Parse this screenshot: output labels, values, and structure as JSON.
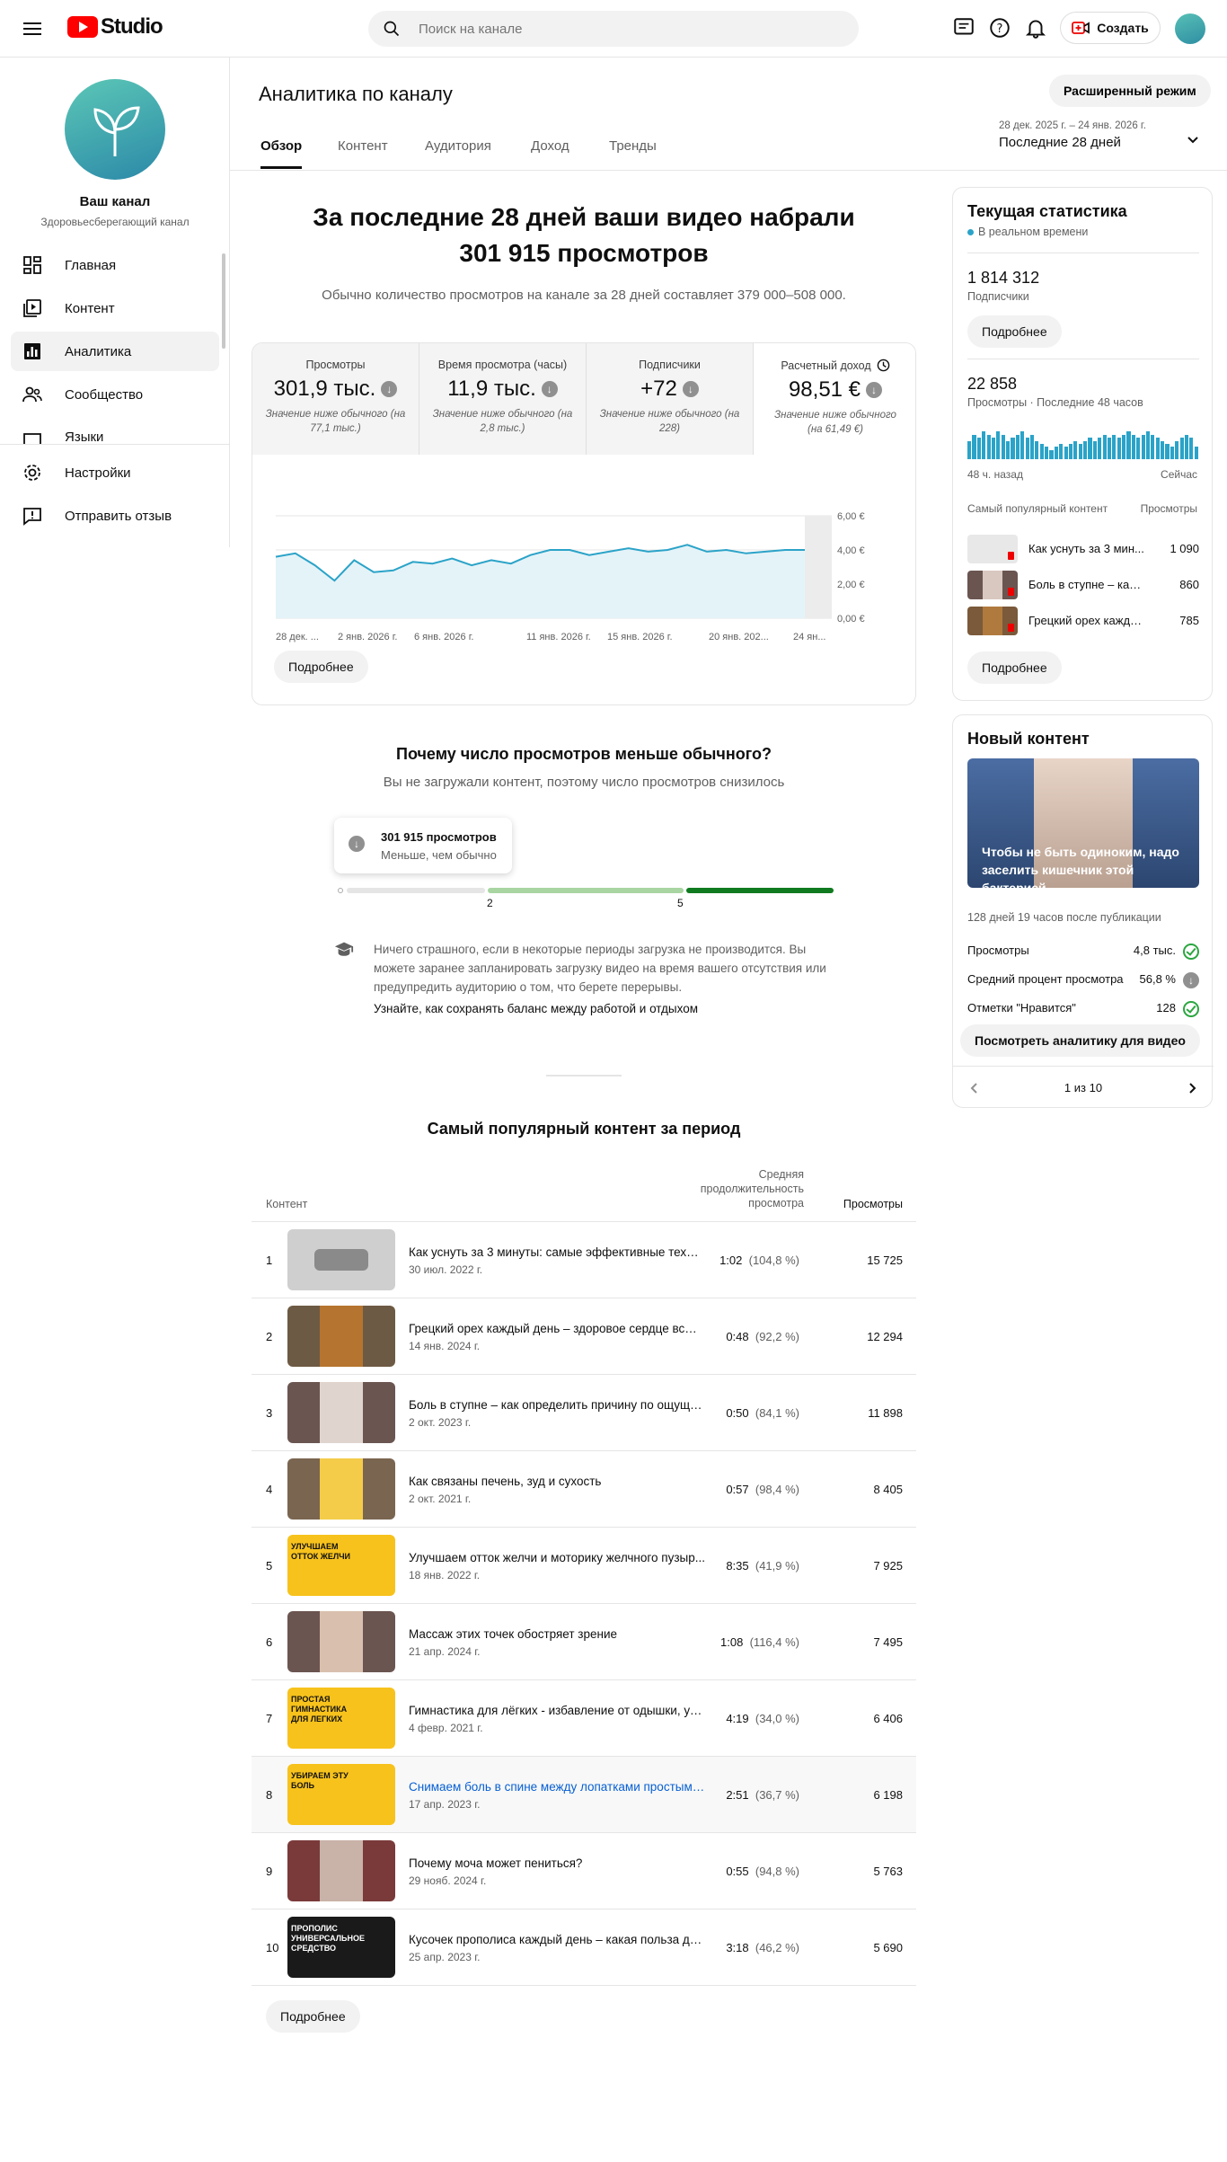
{
  "header": {
    "app_name": "Studio",
    "search_placeholder": "Поиск на канале",
    "create_label": "Создать"
  },
  "sidebar": {
    "channel_name": "Ваш канал",
    "channel_subtitle": "Здоровьесберегающий канал",
    "items": [
      {
        "label": "Главная",
        "icon": "dashboard-icon"
      },
      {
        "label": "Контент",
        "icon": "content-icon"
      },
      {
        "label": "Аналитика",
        "icon": "analytics-icon",
        "active": true
      },
      {
        "label": "Сообщество",
        "icon": "community-icon"
      },
      {
        "label": "Языки",
        "icon": "languages-icon"
      }
    ],
    "bottom_items": [
      {
        "label": "Настройки",
        "icon": "gear-icon"
      },
      {
        "label": "Отправить отзыв",
        "icon": "feedback-icon"
      }
    ]
  },
  "page": {
    "title": "Аналитика по каналу",
    "advanced_label": "Расширенный режим",
    "tabs": [
      "Обзор",
      "Контент",
      "Аудитория",
      "Доход",
      "Тренды"
    ],
    "active_tab": "Обзор",
    "date_range_dates": "28 дек. 2025 г. – 24 янв. 2026 г.",
    "date_range_label": "Последние 28 дней"
  },
  "hero": {
    "title_line1": "За последние 28 дней ваши видео набрали",
    "title_line2": "301 915 просмотров",
    "subtitle": "Обычно количество просмотров на канале за 28 дней составляет 379 000–508 000."
  },
  "metrics": [
    {
      "label": "Просмотры",
      "value": "301,9 тыс.",
      "note": "Значение ниже обычного (на 77,1 тыс.)"
    },
    {
      "label": "Время просмотра (часы)",
      "value": "11,9 тыс.",
      "note": "Значение ниже обычного (на 2,8 тыс.)"
    },
    {
      "label": "Подписчики",
      "value": "+72",
      "note": "Значение ниже обычного (на 228)"
    },
    {
      "label": "Расчетный доход",
      "value": "98,51 €",
      "note": "Значение ниже обычного (на 61,49 €)"
    }
  ],
  "chart_data": {
    "type": "area",
    "y_ticks": [
      "6,00 €",
      "4,00 €",
      "2,00 €",
      "0,00 €"
    ],
    "ylim": [
      0,
      6
    ],
    "x_ticks": [
      "28 дек. ...",
      "2 янв. 2026 г.",
      "6 янв. 2026 г.",
      "11 янв. 2026 г.",
      "15 янв. 2026 г.",
      "20 янв. 202...",
      "24 ян..."
    ],
    "values": [
      3.6,
      3.8,
      3.1,
      2.2,
      3.4,
      2.7,
      2.8,
      3.3,
      3.2,
      3.5,
      3.1,
      3.4,
      3.2,
      3.7,
      4.0,
      4.0,
      3.7,
      3.9,
      4.1,
      3.9,
      4.0,
      4.3,
      3.9,
      4.0,
      3.8,
      3.9,
      4.0,
      4.0
    ]
  },
  "metrics_more_label": "Подробнее",
  "why": {
    "title": "Почему число просмотров меньше обычного?",
    "subtitle": "Вы не загружали контент, поэтому число просмотров снизилось",
    "tooltip_value": "301 915 просмотров",
    "tooltip_status": "Меньше, чем обычно",
    "scale_marks": [
      "2",
      "5"
    ],
    "tip_text": "Ничего страшного, если в некоторые периоды загрузка не производится. Вы можете заранее запланировать загрузку видео на время вашего отсутствия или предупредить аудиторию о том, что берете перерывы.",
    "tip_link": "Узнайте, как сохранять баланс между работой и отдыхом"
  },
  "top_content": {
    "title": "Самый популярный контент за период",
    "col_content": "Контент",
    "col_duration": "Средняя продолжительность просмотра",
    "col_views": "Просмотры",
    "more_label": "Подробнее",
    "rows": [
      {
        "n": "1",
        "title": "Как уснуть за 3 минуты: самые эффективные техни...",
        "date": "30 июл. 2022 г.",
        "dur": "1:02",
        "pct": "(104,8 %)",
        "views": "15 725"
      },
      {
        "n": "2",
        "title": "Грецкий орех каждый день – здоровое сердце всю ...",
        "date": "14 янв. 2024 г.",
        "dur": "0:48",
        "pct": "(92,2 %)",
        "views": "12 294"
      },
      {
        "n": "3",
        "title": "Боль в ступне – как определить причину по ощуще...",
        "date": "2 окт. 2023 г.",
        "dur": "0:50",
        "pct": "(84,1 %)",
        "views": "11 898"
      },
      {
        "n": "4",
        "title": "Как связаны печень, зуд и сухость",
        "date": "2 окт. 2021 г.",
        "dur": "0:57",
        "pct": "(98,4 %)",
        "views": "8 405"
      },
      {
        "n": "5",
        "title": "Улучшаем отток желчи и моторику желчного пузыр...",
        "date": "18 янв. 2022 г.",
        "dur": "8:35",
        "pct": "(41,9 %)",
        "views": "7 925"
      },
      {
        "n": "6",
        "title": "Массаж этих точек обостряет зрение",
        "date": "21 апр. 2024 г.",
        "dur": "1:08",
        "pct": "(116,4 %)",
        "views": "7 495"
      },
      {
        "n": "7",
        "title": "Гимнастика для лёгких - избавление от одышки, уст...",
        "date": "4 февр. 2021 г.",
        "dur": "4:19",
        "pct": "(34,0 %)",
        "views": "6 406"
      },
      {
        "n": "8",
        "title": "Снимаем боль в спине между лопатками простыми...",
        "date": "17 апр. 2023 г.",
        "dur": "2:51",
        "pct": "(36,7 %)",
        "views": "6 198"
      },
      {
        "n": "9",
        "title": "Почему моча может пениться?",
        "date": "29 нояб. 2024 г.",
        "dur": "0:55",
        "pct": "(94,8 %)",
        "views": "5 763"
      },
      {
        "n": "10",
        "title": "Кусочек прополиса каждый день – какая польза дл...",
        "date": "25 апр. 2023 г.",
        "dur": "3:18",
        "pct": "(46,2 %)",
        "views": "5 690"
      }
    ],
    "thumb_texts": {
      "t5": "УЛУЧШАЕМ ОТТОК ЖЕЛЧИ",
      "t7": "ПРОСТАЯ ГИМНАСТИКА ДЛЯ ЛЕГКИХ",
      "t8": "УБИРАЕМ ЭТУ БОЛЬ",
      "t10": "ПРОПОЛИС УНИВЕРСАЛЬНОЕ СРЕДСТВО"
    }
  },
  "realtime": {
    "title": "Текущая статистика",
    "live_label": "В реальном времени",
    "subscribers": "1 814 312",
    "subscribers_label": "Подписчики",
    "more_label": "Подробнее",
    "views48": "22 858",
    "views48_label": "Просмотры · Последние 48 часов",
    "bars": [
      0.6,
      0.8,
      0.7,
      0.9,
      0.8,
      0.7,
      0.9,
      0.8,
      0.6,
      0.7,
      0.8,
      0.9,
      0.7,
      0.8,
      0.6,
      0.5,
      0.4,
      0.3,
      0.4,
      0.5,
      0.4,
      0.5,
      0.6,
      0.5,
      0.6,
      0.7,
      0.6,
      0.7,
      0.8,
      0.7,
      0.8,
      0.7,
      0.8,
      0.9,
      0.8,
      0.7,
      0.8,
      0.9,
      0.8,
      0.7,
      0.6,
      0.5,
      0.4,
      0.6,
      0.7,
      0.8,
      0.7,
      0.4
    ],
    "axis_left": "48 ч. назад",
    "axis_right": "Сейчас",
    "top_label": "Самый популярный контент",
    "views_label": "Просмотры",
    "top_items": [
      {
        "title": "Как уснуть за 3 мин...",
        "views": "1 090"
      },
      {
        "title": "Боль в ступне – как о...",
        "views": "860"
      },
      {
        "title": "Грецкий орех кажды...",
        "views": "785"
      }
    ],
    "more_label2": "Подробнее"
  },
  "new_content": {
    "title": "Новый контент",
    "thumb_caption": "Чтобы не быть одиноким, надо заселить кишечник этой бактерией",
    "age": "128 дней 19 часов после публикации",
    "stats": [
      {
        "label": "Просмотры",
        "value": "4,8 тыс.",
        "status": "check"
      },
      {
        "label": "Средний процент просмотра",
        "value": "56,8 %",
        "status": "down"
      },
      {
        "label": "Отметки \"Нравится\"",
        "value": "128",
        "status": "check"
      }
    ],
    "action_label": "Посмотреть аналитику для видео",
    "pager": "1 из 10"
  },
  "colors": {
    "accent": "#2ba3c8",
    "chart_line": "#2ba3c8",
    "chart_fill": "#e4f3f8",
    "bar_green_light": "#a8d5a2",
    "bar_green_dark": "#0f7a1f"
  }
}
